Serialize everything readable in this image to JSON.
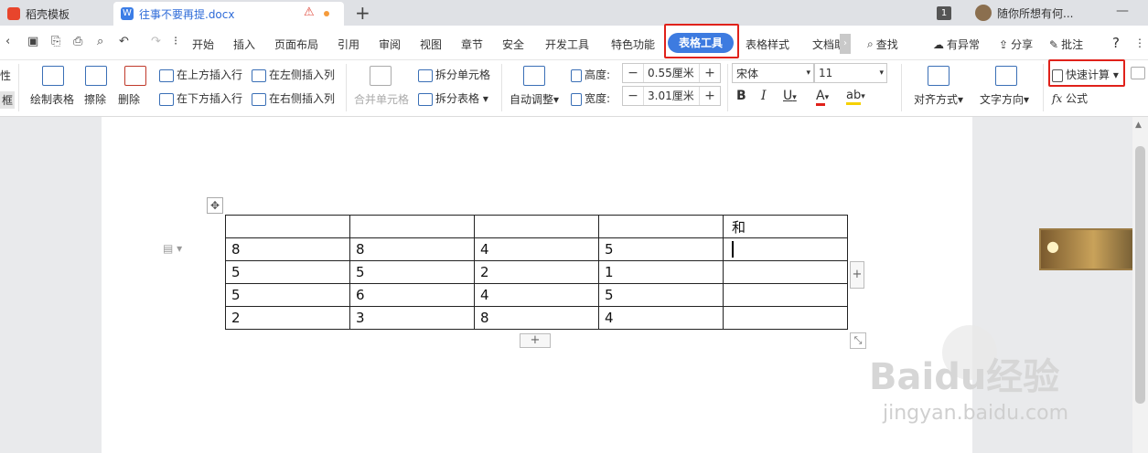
{
  "titlebar": {
    "tab1_label": "稻壳模板",
    "tab2_label": "往事不要再提.docx",
    "warn_icon": "warning-icon",
    "new_tab": "+",
    "window_count": "1",
    "user_name": "随你所想有何...",
    "min_glyph": "—",
    "colors": {
      "tab1_icon": "#e8452c",
      "tab2_icon": "#3b7de6"
    }
  },
  "menubar": {
    "items": [
      "开始",
      "插入",
      "页面布局",
      "引用",
      "审阅",
      "视图",
      "章节",
      "安全",
      "开发工具",
      "特色功能"
    ],
    "active": "表格工具",
    "after": [
      "表格样式",
      "文档助"
    ],
    "search": "查找",
    "right": [
      "有异常",
      "分享",
      "批注"
    ],
    "help": "?",
    "accent": "#3d7be0"
  },
  "ribbon": {
    "left_partial": [
      "性",
      "框"
    ],
    "draw_table": "绘制表格",
    "erase": "擦除",
    "delete": "删除",
    "insert_above": "在上方插入行",
    "insert_below": "在下方插入行",
    "insert_left": "在左侧插入列",
    "insert_right": "在右侧插入列",
    "merge_cells": "合并单元格",
    "split_cells": "拆分单元格",
    "split_table": "拆分表格",
    "auto_fit": "自动调整",
    "height_label": "高度:",
    "height_value": "0.55厘米",
    "width_label": "宽度:",
    "width_value": "3.01厘米",
    "font_name": "宋体",
    "font_size": "11",
    "bold": "B",
    "italic": "I",
    "underline": "U",
    "font_color": "A",
    "highlight": "ab",
    "align": "对齐方式",
    "text_dir": "文字方向",
    "quick_calc": "快速计算",
    "formula": "公式",
    "fx": "fx"
  },
  "table": {
    "rows": [
      [
        "",
        "",
        "",
        "",
        "和"
      ],
      [
        "8",
        "8",
        "4",
        "5",
        ""
      ],
      [
        "5",
        "5",
        "2",
        "1",
        ""
      ],
      [
        "5",
        "6",
        "4",
        "5",
        ""
      ],
      [
        "2",
        "3",
        "8",
        "4",
        ""
      ]
    ]
  },
  "watermark": {
    "line1": "Baidu经验",
    "line2": "jingyan.baidu.com"
  }
}
